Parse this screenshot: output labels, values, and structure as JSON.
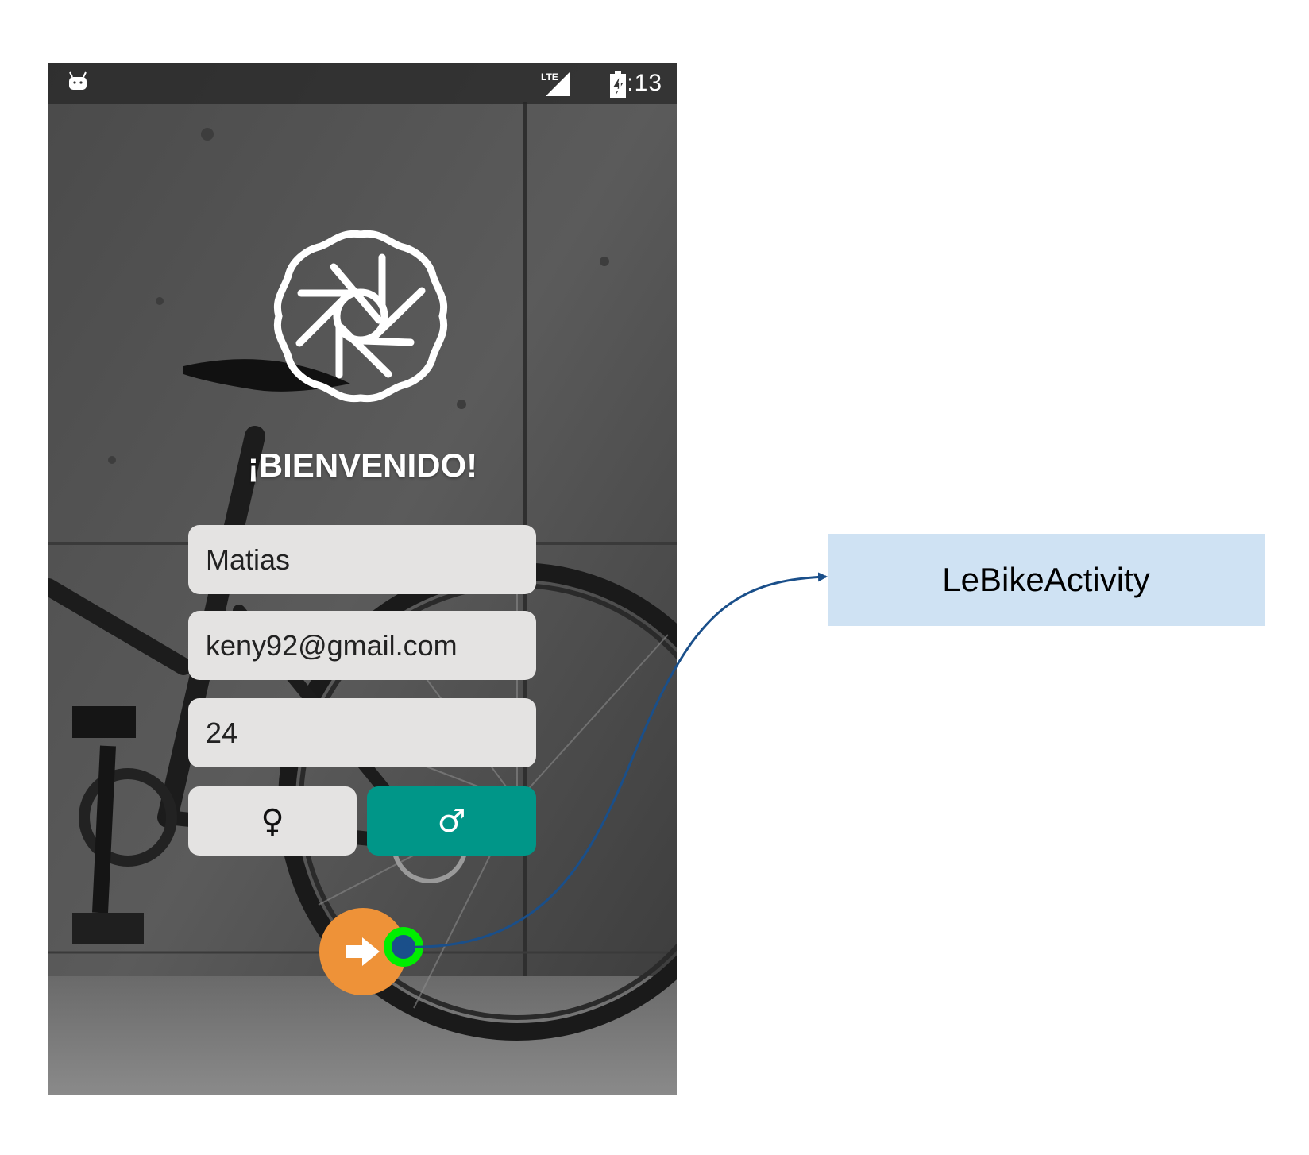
{
  "status_bar": {
    "time": "1:13",
    "network": "LTE",
    "icons": [
      "android-notification-icon",
      "lte-signal-icon",
      "battery-charging-icon"
    ]
  },
  "screen": {
    "logo_icon": "bike-wheel-logo-icon",
    "welcome_text": "¡BIENVENIDO!",
    "fields": {
      "name": "Matias",
      "email": "keny92@gmail.com",
      "age": "24"
    },
    "gender": {
      "female_symbol": "♀",
      "male_symbol": "♂",
      "selected": "male"
    },
    "next_button_icon": "arrow-right-icon"
  },
  "transition": {
    "target_activity": "LeBikeActivity"
  },
  "colors": {
    "selected_gender": "#009688",
    "next_button": "#ee9238",
    "field_background": "#e4e3e2",
    "target_box": "#cfe2f3",
    "connector": "#1a4f8a",
    "marker_ring": "#00ee00"
  }
}
